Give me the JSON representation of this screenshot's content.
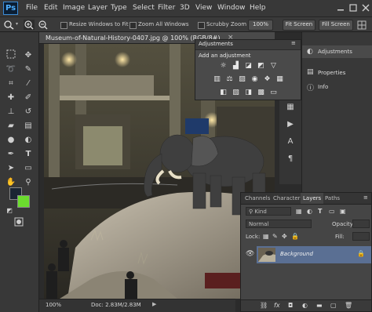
{
  "app": {
    "logo": "Ps"
  },
  "menu": [
    "File",
    "Edit",
    "Image",
    "Layer",
    "Type",
    "Select",
    "Filter",
    "3D",
    "View",
    "Window",
    "Help"
  ],
  "window_controls": {
    "minimize": "minimize-icon",
    "maximize": "maximize-icon",
    "close": "close-icon"
  },
  "options": {
    "resize_windows": "Resize Windows to Fit",
    "zoom_all": "Zoom All Windows",
    "scrubby_zoom": "Scrubby Zoom",
    "zoom_percent": "100%",
    "fit_screen": "Fit Screen",
    "fill_screen": "Fill Screen"
  },
  "document": {
    "tab_title": "Museum-of-Natural-History-0407.jpg @ 100% (RGB/8#)",
    "close_label": "×",
    "zoom": "100%",
    "doc_info": "Doc: 2.83M/2.83M"
  },
  "right_panel": {
    "adjustments": "Adjustments",
    "properties": "Properties",
    "info": "Info"
  },
  "adjustments_panel": {
    "title": "Adjustments",
    "subtitle": "Add an adjustment"
  },
  "layers_panel": {
    "tabs": [
      "Channels",
      "Character",
      "Layers",
      "Paths"
    ],
    "active_tab": "Layers",
    "kind_label": "Kind",
    "blend_mode": "Normal",
    "opacity_label": "Opacity:",
    "lock_label": "Lock:",
    "fill_label": "Fill:",
    "layer_name": "Background"
  },
  "colors": {
    "foreground": "#1b2533",
    "background": "#6bdc2e",
    "selected_layer": "#5a6f93"
  }
}
